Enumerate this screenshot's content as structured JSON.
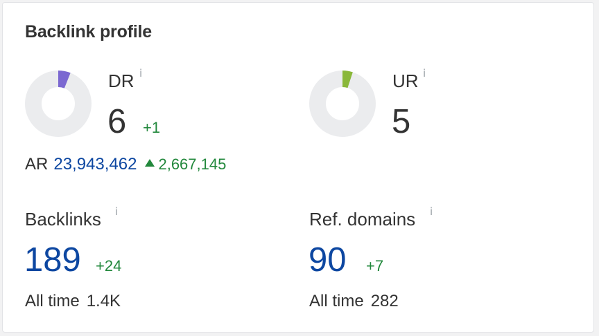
{
  "card": {
    "title": "Backlink profile"
  },
  "colors": {
    "dr_accent": "#7b68d1",
    "ur_accent": "#8ab83a",
    "donut_track": "#ebecee",
    "positive_delta": "#22883c",
    "link_blue": "#0d47a1"
  },
  "dr": {
    "label": "DR",
    "info": "i",
    "value": "6",
    "delta": "+1",
    "fraction": 0.06
  },
  "ur": {
    "label": "UR",
    "info": "i",
    "value": "5",
    "fraction": 0.05
  },
  "ar": {
    "label": "AR",
    "value": "23,943,462",
    "delta": "2,667,145"
  },
  "backlinks": {
    "label": "Backlinks",
    "info": "i",
    "value": "189",
    "delta": "+24",
    "all_time_label": "All time",
    "all_time_value": "1.4K"
  },
  "ref_domains": {
    "label": "Ref. domains",
    "info": "i",
    "value": "90",
    "delta": "+7",
    "all_time_label": "All time",
    "all_time_value": "282"
  }
}
